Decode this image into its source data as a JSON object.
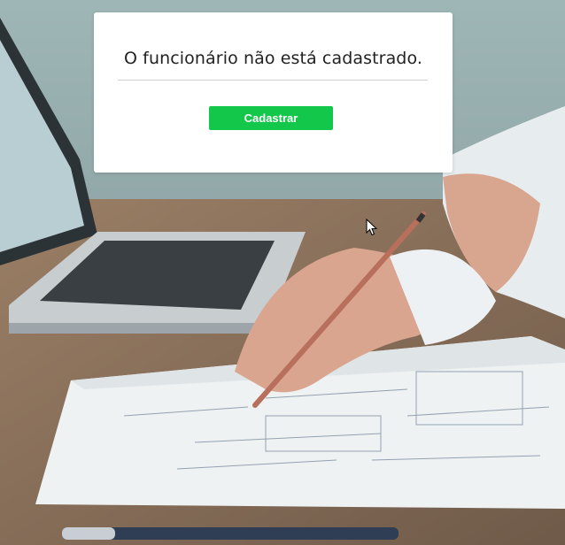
{
  "dialog": {
    "message": "O funcionário não está cadastrado.",
    "register_label": "Cadastrar"
  },
  "colors": {
    "button_green": "#12c74a",
    "modal_bg": "#ffffff"
  },
  "icons": {
    "cursor": "mouse-pointer-icon"
  }
}
